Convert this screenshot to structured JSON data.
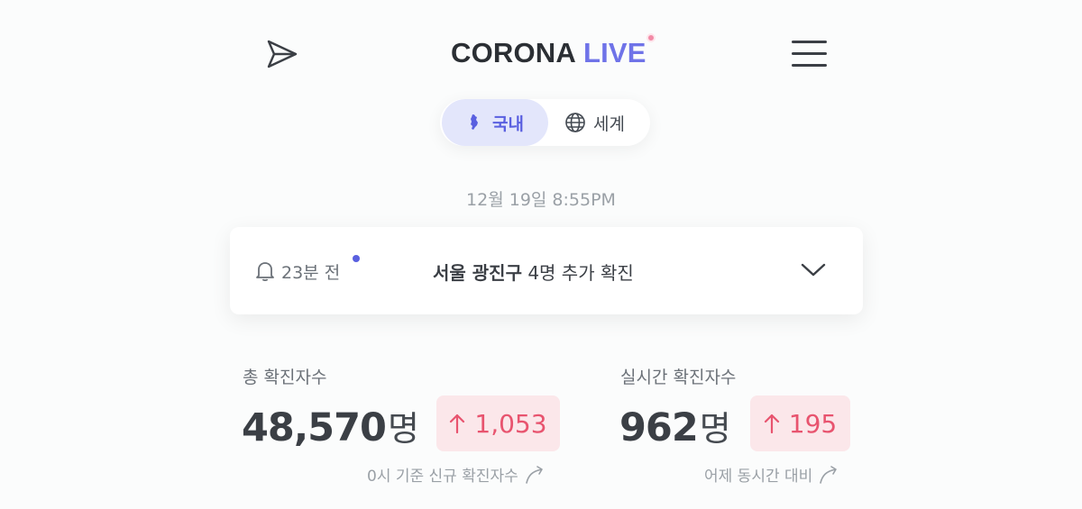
{
  "header": {
    "logo_main": "CORONA",
    "logo_accent": "LIVE",
    "icons": {
      "left": "send-icon",
      "right": "menu-icon"
    }
  },
  "tabs": [
    {
      "label": "국내",
      "icon": "korea-map-icon",
      "active": true
    },
    {
      "label": "세계",
      "icon": "globe-icon",
      "active": false
    }
  ],
  "timestamp": "12월 19일 8:55PM",
  "notice": {
    "time_ago": "23분 전",
    "location": "서울 광진구",
    "text": " 4명 추가 확진"
  },
  "stats": {
    "total": {
      "label": "총 확진자수",
      "value": "48,570",
      "unit": "명",
      "delta": "1,053",
      "note": "0시 기준 신규 확진자수"
    },
    "realtime": {
      "label": "실시간 확진자수",
      "value": "962",
      "unit": "명",
      "delta": "195",
      "note": "어제 동시간 대비"
    }
  },
  "colors": {
    "accent": "#5a60e0",
    "logo_live": "#6f73e8",
    "delta_text": "#e8546f",
    "delta_bg": "#fbe7ea",
    "active_tab_bg": "#e3e6fb"
  }
}
